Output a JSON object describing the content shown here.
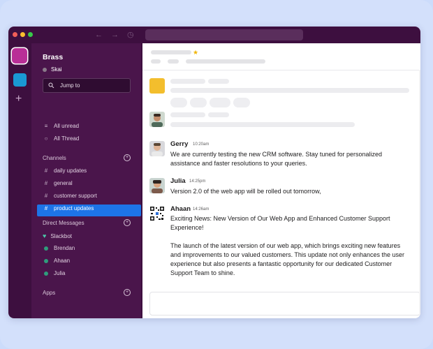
{
  "workspace": {
    "name": "Brass",
    "user": "Skai"
  },
  "sidebar": {
    "jump_to": "Jump to",
    "nav": [
      {
        "label": "All unread",
        "icon": "unread-icon"
      },
      {
        "label": "All Thread",
        "icon": "thread-icon"
      }
    ],
    "channels_header": "Channels",
    "channels": [
      {
        "label": "daily updates"
      },
      {
        "label": "general"
      },
      {
        "label": "customer support"
      },
      {
        "label": "product updates",
        "active": true
      }
    ],
    "dm_header": "Direct Messages",
    "dms": [
      {
        "label": "Slackbot"
      },
      {
        "label": "Brendan"
      },
      {
        "label": "Ahaan"
      },
      {
        "label": "Julia"
      }
    ],
    "apps_header": "Apps"
  },
  "messages": [
    {
      "author": "Gerry",
      "time": "10:20am",
      "text": "We are currently testing the new CRM software. Stay tuned for personalized assistance and faster resolutions to your queries."
    },
    {
      "author": "Julia",
      "time": "14:25pm",
      "text": "Version 2.0 of the web app will be rolled out tomorrow,"
    },
    {
      "author": "Ahaan",
      "time": "14:26am",
      "title": "Exciting News: New Version of Our Web App and Enhanced Customer Support Experience!",
      "text": "The launch of the latest version of our web app, which brings exciting new features and improvements to our valued customers. This update not only enhances the user experience but also presents a fantastic opportunity for our dedicated Customer Support Team to shine."
    }
  ],
  "colors": {
    "sidebar_bg": "#4a154b",
    "active_channel": "#1d74e8",
    "workspace_accent": "#b92f97"
  }
}
